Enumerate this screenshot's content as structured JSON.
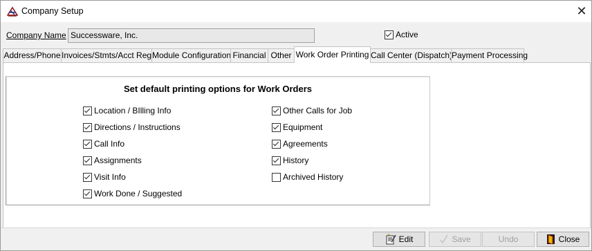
{
  "window": {
    "title": "Company Setup"
  },
  "company": {
    "label": "Company Name",
    "value": "Successware, Inc.",
    "active_label": "Active",
    "active_checked": true
  },
  "tabs": [
    {
      "label": "Address/Phone"
    },
    {
      "label": "Invoices/Stmts/Acct Reg"
    },
    {
      "label": "Module Configuration"
    },
    {
      "label": "Financial"
    },
    {
      "label": "Other"
    },
    {
      "label": "Work Order Printing"
    },
    {
      "label": "Call Center (Dispatch)"
    },
    {
      "label": "Payment Processing"
    }
  ],
  "selected_tab": "Work Order Printing",
  "printing": {
    "heading": "Set default printing options for Work Orders",
    "left": [
      {
        "label": "Location / BIlling Info",
        "checked": true
      },
      {
        "label": "Directions / Instructions",
        "checked": true
      },
      {
        "label": "Call Info",
        "checked": true
      },
      {
        "label": "Assignments",
        "checked": true
      },
      {
        "label": "Visit Info",
        "checked": true
      },
      {
        "label": "Work Done / Suggested",
        "checked": true
      }
    ],
    "right": [
      {
        "label": "Other Calls for Job",
        "checked": true
      },
      {
        "label": "Equipment",
        "checked": true
      },
      {
        "label": "Agreements",
        "checked": true
      },
      {
        "label": "History",
        "checked": true
      },
      {
        "label": "Archived History",
        "checked": false
      }
    ]
  },
  "buttons": {
    "edit": "Edit",
    "save": "Save",
    "undo": "Undo",
    "close": "Close"
  },
  "colors": {
    "tab_border": "#c4c4c4",
    "disabled_text": "#a0a0a0"
  }
}
